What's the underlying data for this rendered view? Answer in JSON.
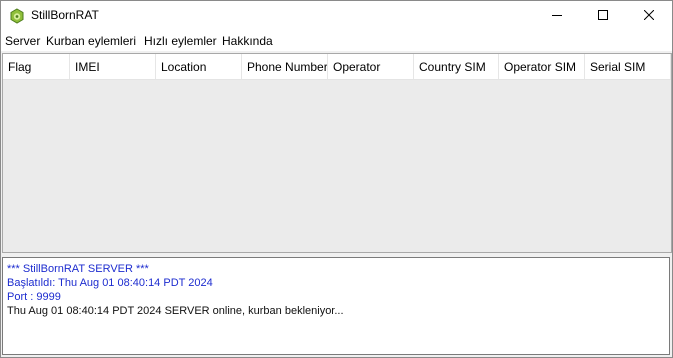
{
  "window": {
    "title": "StillBornRAT"
  },
  "titlebar": {
    "icon": "android-icon",
    "minimize": "minimize-icon",
    "maximize": "maximize-icon",
    "close": "close-icon"
  },
  "menu": [
    "Server",
    "Kurban eylemleri",
    "Hızlı eylemler",
    "Hakkında"
  ],
  "table": {
    "columns": [
      "Flag",
      "IMEI",
      "Location",
      "Phone Number",
      "Operator",
      "Country SIM",
      "Operator SIM",
      "Serial SIM"
    ],
    "rows": []
  },
  "log": {
    "lines": [
      {
        "text": "*** StillBornRAT SERVER ***",
        "color": "#1d2ccf"
      },
      {
        "text": "Başlatıldı: Thu Aug 01 08:40:14 PDT 2024",
        "color": "#1d2ccf"
      },
      {
        "text": "Port : 9999",
        "color": "#1d2ccf"
      },
      {
        "text": "Thu Aug 01 08:40:14 PDT 2024 SERVER online, kurban bekleniyor...",
        "color": "#111111"
      }
    ]
  }
}
